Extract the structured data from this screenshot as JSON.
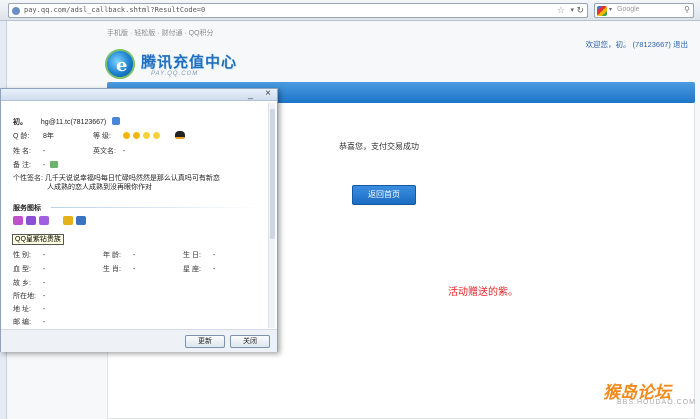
{
  "browser": {
    "url": "pay.qq.com/adsl_callback.shtml?ResultCode=0",
    "search_placeholder": "Google",
    "star_icon": "star-icon",
    "reload_icon": "reload-icon"
  },
  "page": {
    "topnav": "手机版 · 轻松版 · 财付通 · QQ积分",
    "welcome": "欢迎您，初。 (78123667) 退出",
    "logo_text": "腾讯充值中心",
    "logo_sub": "PAY.QQ.COM",
    "success_msg": "恭喜您，支付交易成功",
    "home_button": "返回首页",
    "gift_note": "活动赠送的紫。",
    "watermark": "猴岛论坛",
    "watermark_sub": "BBS.HOUDAO.COM"
  },
  "dialog": {
    "min_icon": "_",
    "close_icon": "×",
    "nickname": "初。",
    "account": "hg@11.tc(78123667)",
    "q_age_label": "Q    龄:",
    "q_age_value": "8年",
    "level_label": "等    级:",
    "name_label": "姓    名:",
    "name_value": "-",
    "eng_name_label": "英文名:",
    "eng_name_value": "-",
    "remark_label": "备    注:",
    "remark_value": "-",
    "signature_label": "个性签名:",
    "signature_line1": "几千天说说幸福吗每日忙碌吗然然是那么认真吗可有新恋",
    "signature_line2": "人成熟的恋人成熟到没再眼你作对",
    "service_title": "服务图标",
    "tooltip": "QQ皇紫钻贵族",
    "fields": [
      {
        "label": "性    别:",
        "value": "-"
      },
      {
        "label": "年    龄:",
        "value": "-"
      },
      {
        "label": "生    日:",
        "value": "-"
      },
      {
        "label": "血    型:",
        "value": "-"
      },
      {
        "label": "生    肖:",
        "value": "-"
      },
      {
        "label": "星    座:",
        "value": "-"
      },
      {
        "label": "故    乡:",
        "value": "-"
      },
      {
        "label": "所在地:",
        "value": "-"
      },
      {
        "label": "地    址:",
        "value": "-"
      },
      {
        "label": "邮    编:",
        "value": "-"
      }
    ],
    "refresh_button": "更新",
    "close_button": "关闭"
  },
  "colors": {
    "accent_blue": "#1d75c9",
    "gift_red": "#e3262a",
    "watermark_orange": "#f08a1c"
  }
}
